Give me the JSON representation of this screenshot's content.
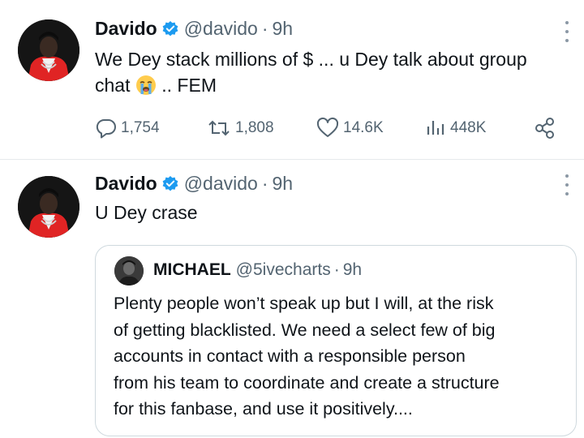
{
  "tweets": [
    {
      "author_name": "Davido",
      "handle": "@davido",
      "separator": "·",
      "time": "9h",
      "text_line1": "We Dey stack millions of $ ... u Dey talk about group",
      "text_line2_before_emoji": "chat",
      "emoji": "loudly-crying-face",
      "text_line2_after_emoji": " .. FEM",
      "replies": "1,754",
      "reposts": "1,808",
      "likes": "14.6K",
      "views": "448K"
    },
    {
      "author_name": "Davido",
      "handle": "@davido",
      "separator": "·",
      "time": "9h",
      "text": "U Dey crase",
      "quote": {
        "author_name": "MICHAEL",
        "handle": "@5ivecharts",
        "separator": "·",
        "time": "9h",
        "lines": [
          "Plenty people won’t speak up but I will, at the risk",
          "of getting blacklisted. We need a select few of big",
          "accounts in contact with a responsible person",
          "from his team to coordinate and create a structure",
          "for this fanbase, and use it positively...."
        ]
      }
    }
  ],
  "icons": {
    "verified": "verified-badge-icon",
    "more": "more-options-icon",
    "reply": "reply-icon",
    "repost": "repost-icon",
    "like": "heart-icon",
    "views": "views-icon",
    "share": "share-icon"
  },
  "colors": {
    "verified_blue": "#1d9bf0",
    "text_primary": "#0f1419",
    "text_secondary": "#536471",
    "border": "#cfd9de"
  }
}
